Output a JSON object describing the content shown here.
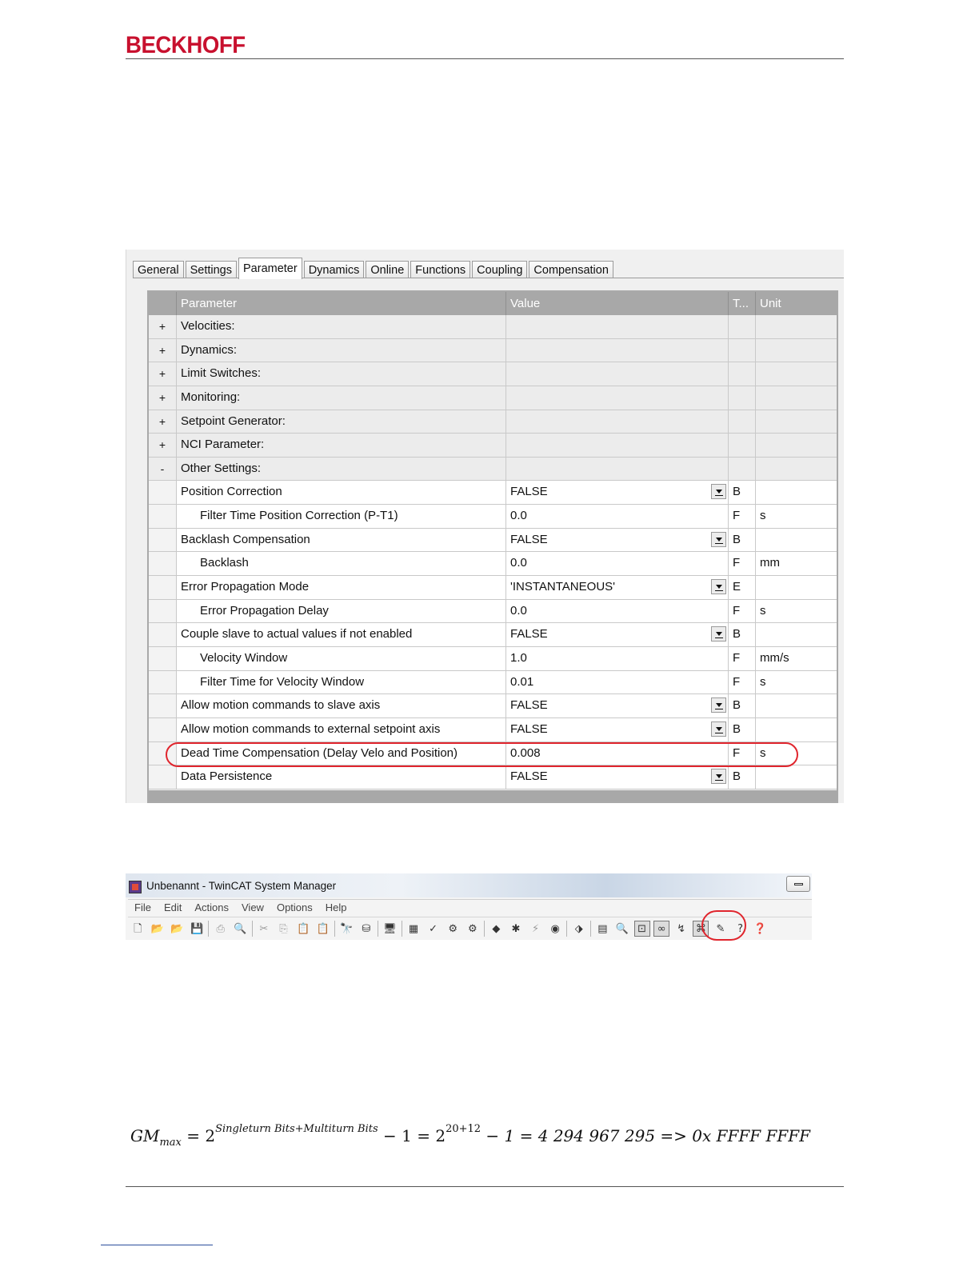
{
  "header": {
    "logo_text": "BECKHOFF"
  },
  "parameter_dialog": {
    "tabs": [
      {
        "label": "General"
      },
      {
        "label": "Settings"
      },
      {
        "label": "Parameter",
        "active": true
      },
      {
        "label": "Dynamics"
      },
      {
        "label": "Online"
      },
      {
        "label": "Functions"
      },
      {
        "label": "Coupling"
      },
      {
        "label": "Compensation"
      }
    ],
    "columns": [
      "Parameter",
      "Value",
      "T...",
      "Unit"
    ],
    "rows": [
      {
        "expander": "+",
        "name": "Velocities:",
        "value": "",
        "type": "",
        "unit": "",
        "kind": "group"
      },
      {
        "expander": "+",
        "name": "Dynamics:",
        "value": "",
        "type": "",
        "unit": "",
        "kind": "group"
      },
      {
        "expander": "+",
        "name": "Limit Switches:",
        "value": "",
        "type": "",
        "unit": "",
        "kind": "group"
      },
      {
        "expander": "+",
        "name": "Monitoring:",
        "value": "",
        "type": "",
        "unit": "",
        "kind": "group"
      },
      {
        "expander": "+",
        "name": "Setpoint Generator:",
        "value": "",
        "type": "",
        "unit": "",
        "kind": "group"
      },
      {
        "expander": "+",
        "name": "NCI Parameter:",
        "value": "",
        "type": "",
        "unit": "",
        "kind": "group"
      },
      {
        "expander": "-",
        "name": "Other Settings:",
        "value": "",
        "type": "",
        "unit": "",
        "kind": "group"
      },
      {
        "expander": "",
        "name": "Position Correction",
        "value": "FALSE",
        "type": "B",
        "unit": "",
        "kind": "item",
        "dropdown": true
      },
      {
        "expander": "",
        "name": "Filter Time Position Correction (P-T1)",
        "value": "0.0",
        "type": "F",
        "unit": "s",
        "kind": "item",
        "indent": true
      },
      {
        "expander": "",
        "name": "Backlash Compensation",
        "value": "FALSE",
        "type": "B",
        "unit": "",
        "kind": "item",
        "dropdown": true
      },
      {
        "expander": "",
        "name": "Backlash",
        "value": "0.0",
        "type": "F",
        "unit": "mm",
        "kind": "item",
        "indent": true
      },
      {
        "expander": "",
        "name": "Error Propagation Mode",
        "value": "'INSTANTANEOUS'",
        "type": "E",
        "unit": "",
        "kind": "item",
        "dropdown": true
      },
      {
        "expander": "",
        "name": "Error Propagation Delay",
        "value": "0.0",
        "type": "F",
        "unit": "s",
        "kind": "item",
        "indent": true
      },
      {
        "expander": "",
        "name": "Couple slave to actual values if not enabled",
        "value": "FALSE",
        "type": "B",
        "unit": "",
        "kind": "item",
        "dropdown": true
      },
      {
        "expander": "",
        "name": "Velocity Window",
        "value": "1.0",
        "type": "F",
        "unit": "mm/s",
        "kind": "item",
        "indent": true
      },
      {
        "expander": "",
        "name": "Filter Time for Velocity Window",
        "value": "0.01",
        "type": "F",
        "unit": "s",
        "kind": "item",
        "indent": true
      },
      {
        "expander": "",
        "name": "Allow motion commands to slave axis",
        "value": "FALSE",
        "type": "B",
        "unit": "",
        "kind": "item",
        "dropdown": true
      },
      {
        "expander": "",
        "name": "Allow motion commands to external setpoint axis",
        "value": "FALSE",
        "type": "B",
        "unit": "",
        "kind": "item",
        "dropdown": true
      },
      {
        "expander": "",
        "name": "Dead Time Compensation (Delay Velo and Position)",
        "value": "0.008",
        "type": "F",
        "unit": "s",
        "kind": "item",
        "highlighted": true
      },
      {
        "expander": "",
        "name": "Data Persistence",
        "value": "FALSE",
        "type": "B",
        "unit": "",
        "kind": "item",
        "dropdown": true
      }
    ],
    "highlight_color": "#e0252d"
  },
  "system_manager": {
    "title": "Unbenannt - TwinCAT System Manager",
    "menu": [
      "File",
      "Edit",
      "Actions",
      "View",
      "Options",
      "Help"
    ],
    "toolbar": [
      {
        "icon": "new-file-icon",
        "glyph": "🗋"
      },
      {
        "icon": "open-folder-icon",
        "glyph": "📂"
      },
      {
        "icon": "open-project-icon",
        "glyph": "📂"
      },
      {
        "icon": "save-icon",
        "glyph": "💾"
      },
      {
        "sep": true
      },
      {
        "icon": "print-icon",
        "glyph": "⎙",
        "dim": true
      },
      {
        "icon": "print-preview-icon",
        "glyph": "🔍",
        "dim": true
      },
      {
        "sep": true
      },
      {
        "icon": "cut-icon",
        "glyph": "✂",
        "dim": true
      },
      {
        "icon": "copy-icon",
        "glyph": "⎘",
        "dim": true
      },
      {
        "icon": "paste-icon",
        "glyph": "📋",
        "dim": true
      },
      {
        "icon": "paste-with-links-icon",
        "glyph": "📋",
        "dim": true
      },
      {
        "sep": true
      },
      {
        "icon": "find-icon",
        "glyph": "🔭"
      },
      {
        "icon": "find-next-icon",
        "glyph": "⛁"
      },
      {
        "sep": true
      },
      {
        "icon": "target-system-icon",
        "glyph": "🖥"
      },
      {
        "sep": true
      },
      {
        "icon": "generate-mappings-icon",
        "glyph": "▦"
      },
      {
        "icon": "check-configuration-icon",
        "glyph": "✓"
      },
      {
        "icon": "activate-configuration-icon",
        "glyph": "⚙"
      },
      {
        "icon": "restart-run-mode-icon",
        "glyph": "⚙"
      },
      {
        "sep": true
      },
      {
        "icon": "restart-config-mode-icon",
        "glyph": "◆"
      },
      {
        "icon": "load-io-devices-icon",
        "glyph": "✱"
      },
      {
        "icon": "scan-boxes-icon",
        "glyph": "⚡",
        "dim": true
      },
      {
        "icon": "toggle-free-run-icon",
        "glyph": "◉"
      },
      {
        "sep": true
      },
      {
        "icon": "force-icon",
        "glyph": "⬗"
      },
      {
        "sep": true
      },
      {
        "icon": "show-online-data-icon",
        "glyph": "▤"
      },
      {
        "icon": "zoom-icon",
        "glyph": "🔍"
      },
      {
        "icon": "show-sub-items-icon",
        "glyph": "⊡",
        "pressed": true
      },
      {
        "icon": "show-online-links-icon",
        "glyph": "∞",
        "pressed": true
      },
      {
        "icon": "show-comm-icon",
        "glyph": "↯"
      },
      {
        "icon": "dead-time-icon",
        "glyph": "⌘",
        "pressed": true
      },
      {
        "icon": "security-icon",
        "glyph": "✎"
      },
      {
        "icon": "help-index-icon",
        "glyph": "?"
      },
      {
        "icon": "help-icon",
        "glyph": "❓"
      }
    ]
  },
  "formula": {
    "lhs_main": "GM",
    "lhs_sub": "max",
    "eq": " = 2",
    "exp1": "Singleturn Bits+Multiturn Bits",
    "mid": " − 1 = 2",
    "exp2": "20+12",
    "rhs": " − 1 = 4 294 967 295 => 0x FFFF FFFF"
  }
}
